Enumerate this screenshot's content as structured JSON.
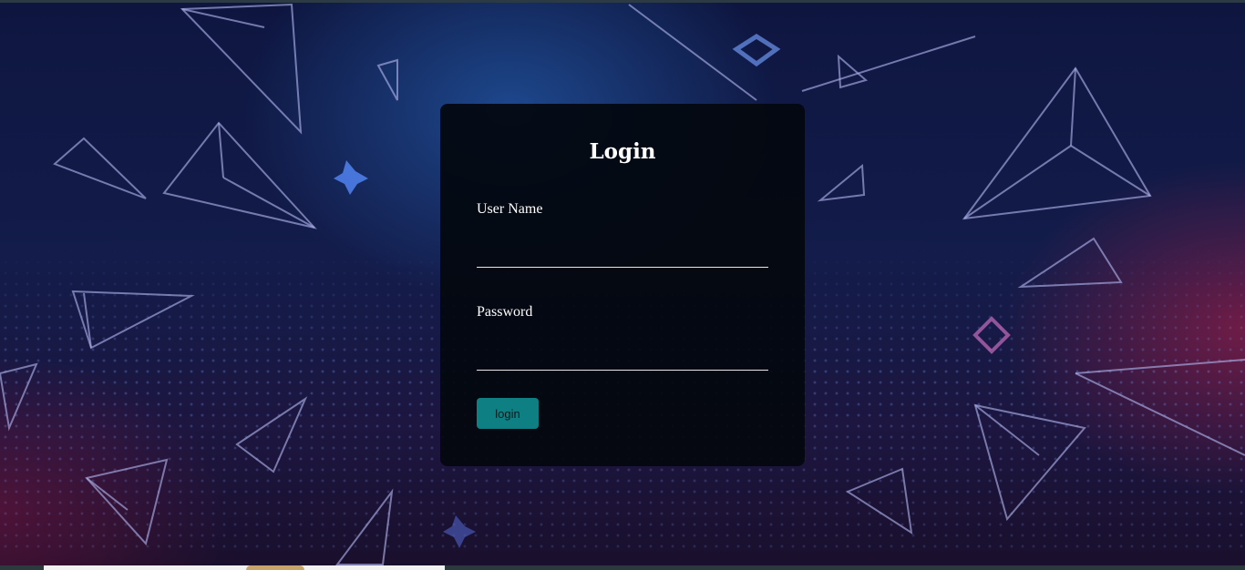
{
  "login_form": {
    "title": "Login",
    "username_label": "User Name",
    "username_value": "",
    "password_label": "Password",
    "password_value": "",
    "submit_label": "login"
  },
  "colors": {
    "card_background": "#03080e",
    "button_background": "#0e7f82",
    "text": "#ffffff"
  },
  "background": {
    "icons": [
      "triangle-outline-icon",
      "diamond-outline-icon",
      "cross-star-icon"
    ]
  }
}
